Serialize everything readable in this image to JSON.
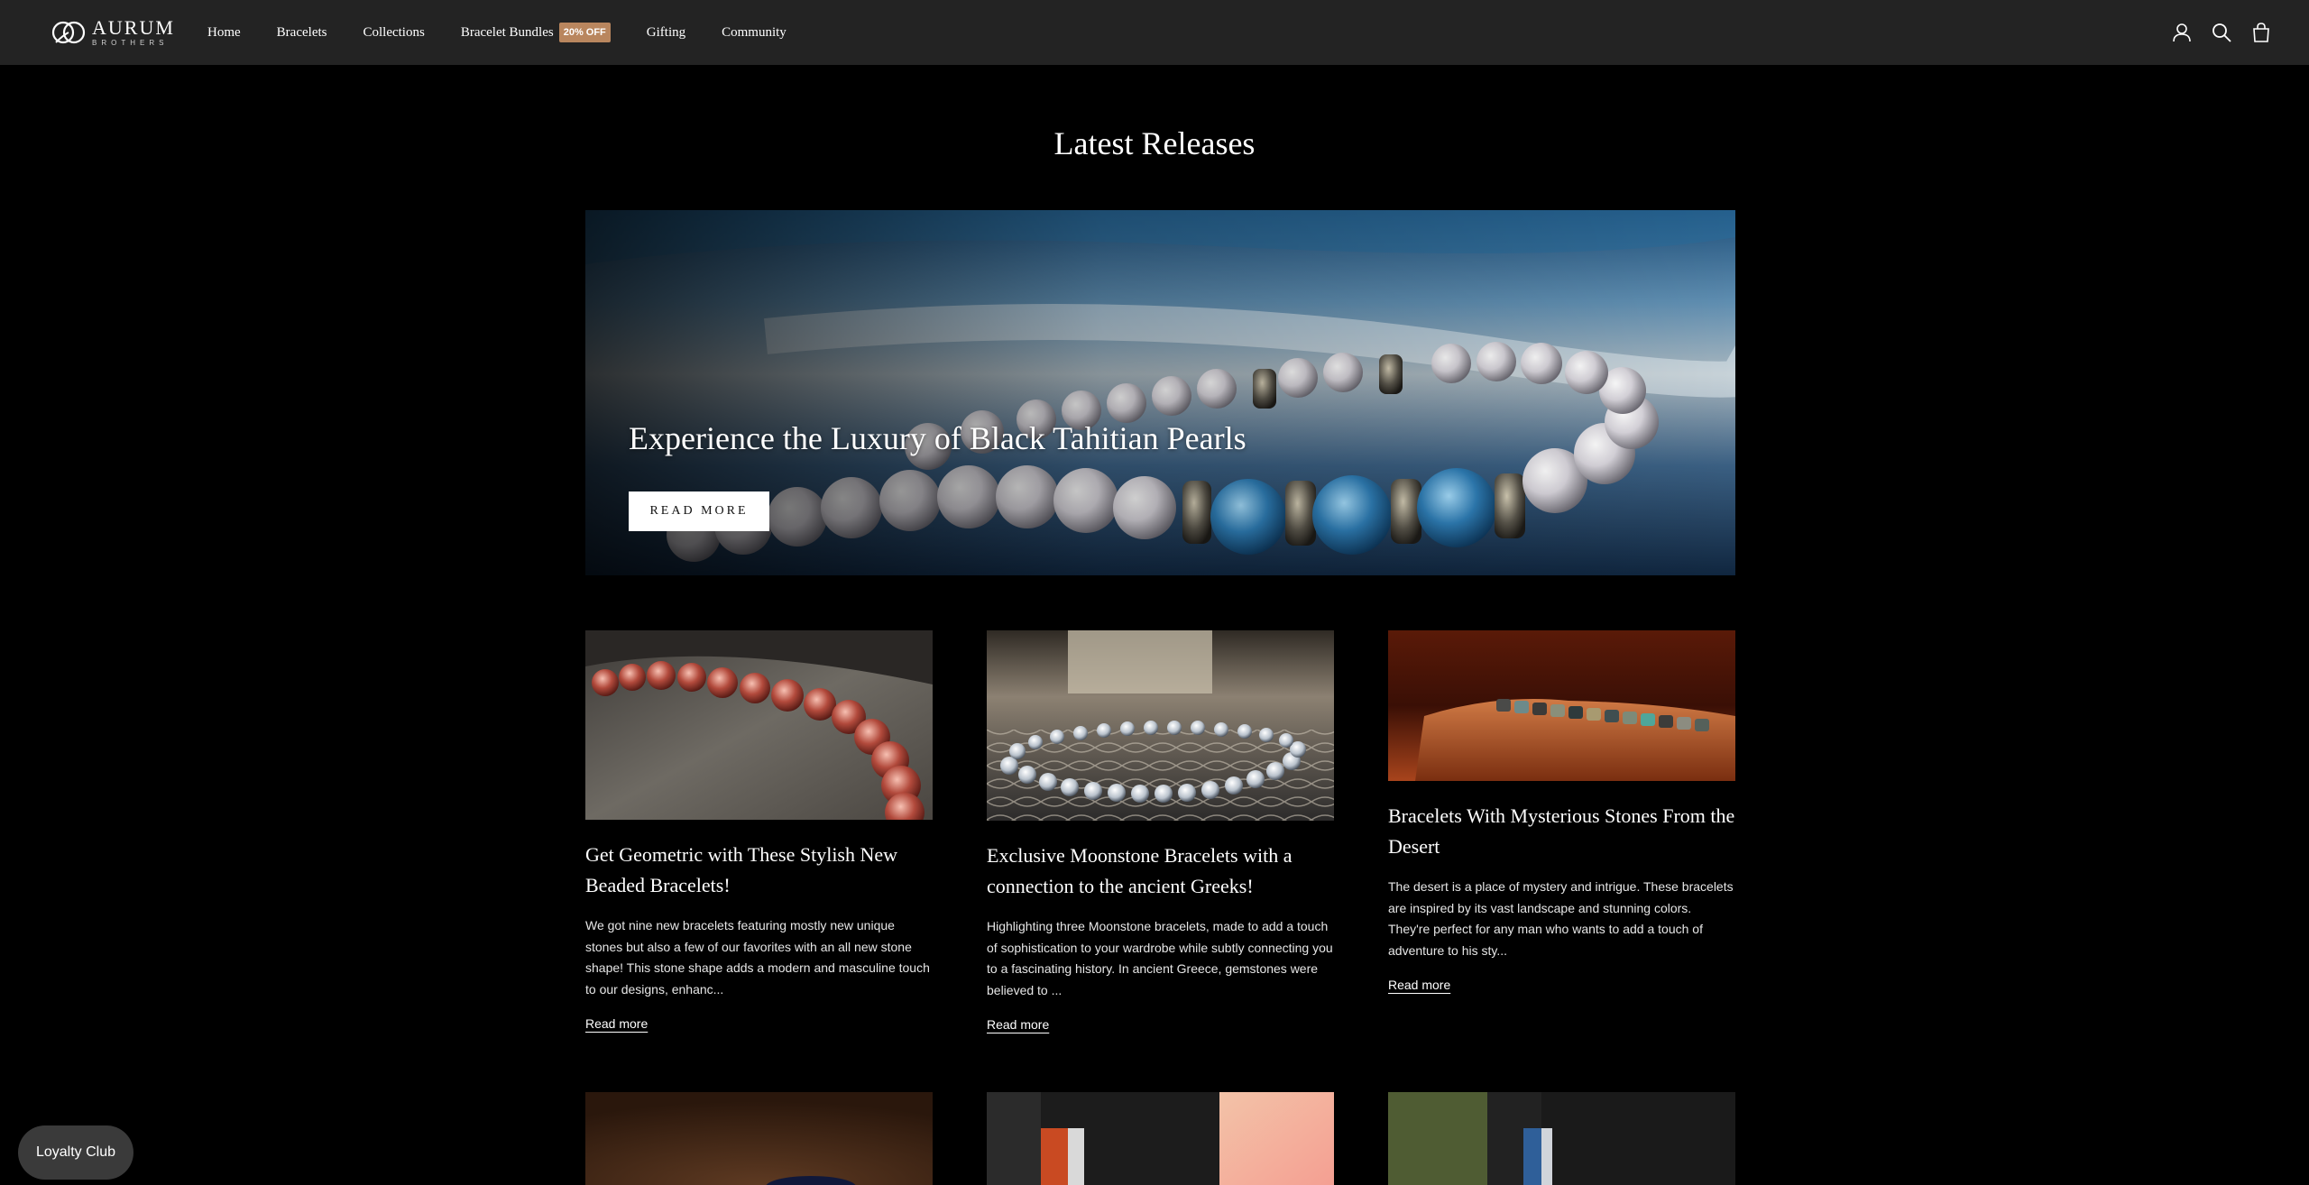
{
  "brand": {
    "name": "AURUM",
    "sub": "BROTHERS"
  },
  "nav": {
    "items": [
      {
        "label": "Home"
      },
      {
        "label": "Bracelets"
      },
      {
        "label": "Collections"
      },
      {
        "label": "Bracelet Bundles",
        "badge": "20% OFF"
      },
      {
        "label": "Gifting"
      },
      {
        "label": "Community"
      }
    ]
  },
  "header_icons": [
    "account-icon",
    "search-icon",
    "cart-icon"
  ],
  "page": {
    "title": "Latest Releases"
  },
  "hero": {
    "title": "Experience the Luxury of Black Tahitian Pearls",
    "button": "READ MORE"
  },
  "articles": [
    {
      "title": "Get Geometric with These Stylish New Beaded Bracelets!",
      "excerpt": "We got nine new bracelets featuring mostly new unique stones but also a few of our favorites with an all new stone shape! This stone shape adds a modern and masculine touch to our designs, enhanc...",
      "link": "Read more"
    },
    {
      "title": "Exclusive Moonstone Bracelets with a connection to the ancient Greeks!",
      "excerpt": "Highlighting three Moonstone bracelets, made to add a touch of sophistication to your wardrobe while subtly connecting you to a fascinating history. In ancient Greece, gemstones were believed to ...",
      "link": "Read more"
    },
    {
      "title": "Bracelets With Mysterious Stones From the Desert",
      "excerpt": "The desert is a place of mystery and intrigue. These bracelets are inspired by its vast landscape and stunning colors. They're perfect for any man who wants to add a touch of adventure to his sty...",
      "link": "Read more"
    }
  ],
  "loyalty": {
    "label": "Loyalty Club"
  },
  "colors": {
    "header_bg": "#232323",
    "badge_bg": "#b9865e",
    "page_bg": "#000000"
  }
}
